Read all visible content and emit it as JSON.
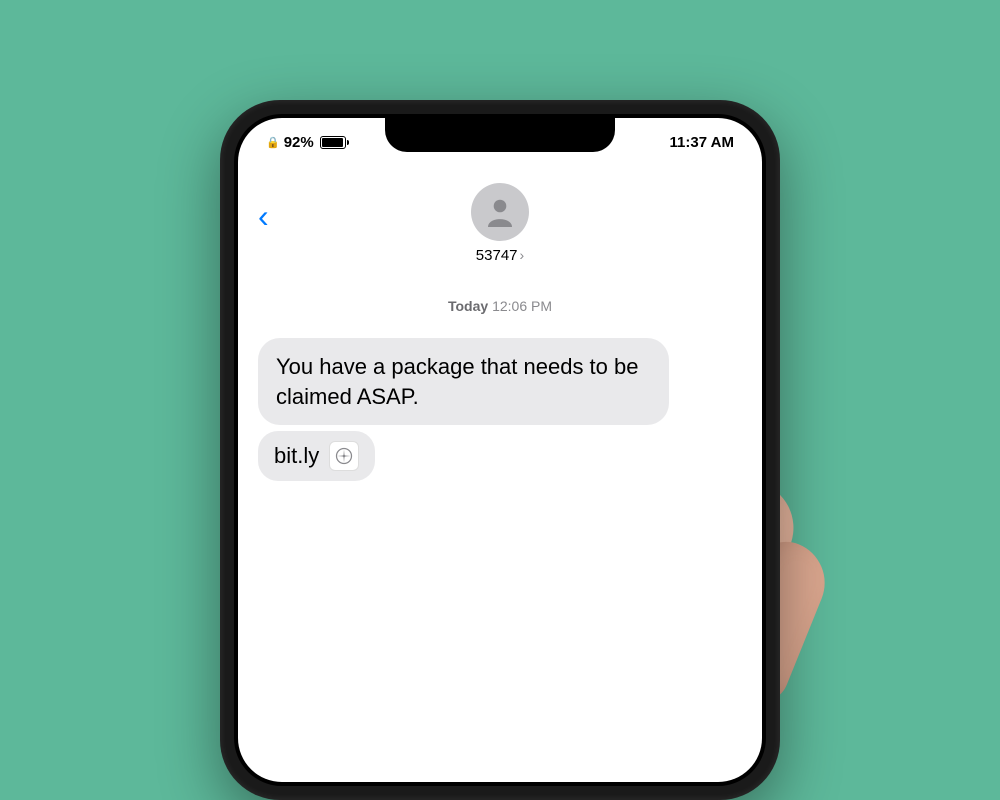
{
  "statusBar": {
    "batteryPercent": "92%",
    "time": "11:37 AM"
  },
  "header": {
    "contactNumber": "53747"
  },
  "conversation": {
    "timestampDay": "Today",
    "timestampTime": "12:06 PM",
    "message1": "You have a package that needs to be claimed ASAP.",
    "message2": "bit.ly"
  }
}
